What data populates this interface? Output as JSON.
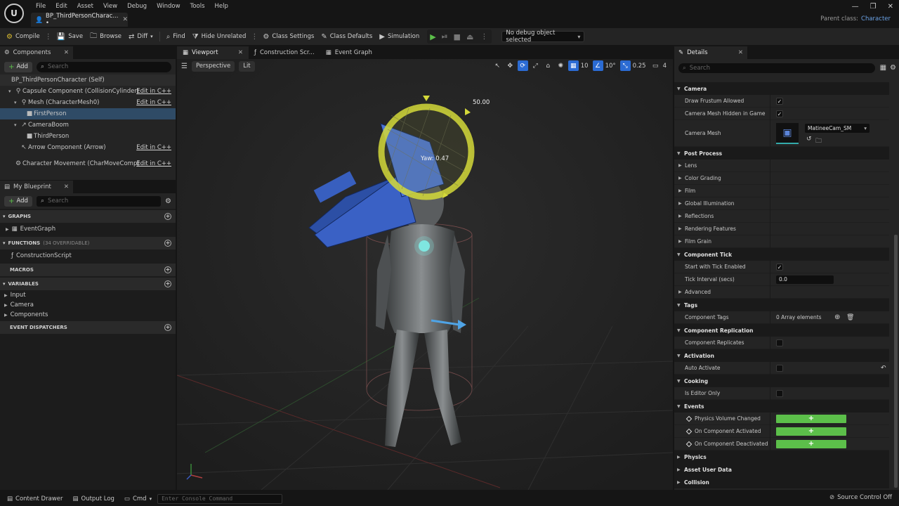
{
  "menu": [
    "File",
    "Edit",
    "Asset",
    "View",
    "Debug",
    "Window",
    "Tools",
    "Help"
  ],
  "asset_tab": {
    "title": "BP_ThirdPersonCharac... •",
    "close": "✕"
  },
  "window_controls": {
    "minimize": "—",
    "maximize": "❐",
    "close": "✕"
  },
  "parent_class": {
    "label": "Parent class:",
    "value": "Character"
  },
  "toolbar": {
    "compile": "Compile",
    "save": "Save",
    "browse": "Browse",
    "diff": "Diff",
    "find": "Find",
    "hide_unrelated": "Hide Unrelated",
    "class_settings": "Class Settings",
    "class_defaults": "Class Defaults",
    "simulation": "Simulation",
    "debug_object": "No debug object selected"
  },
  "components": {
    "title": "Components",
    "add": "Add",
    "search_placeholder": "Search",
    "items": [
      {
        "label": "BP_ThirdPersonCharacter (Self)",
        "edit": ""
      },
      {
        "label": "Capsule Component (CollisionCylinder)",
        "edit": "Edit in C++"
      },
      {
        "label": "Mesh (CharacterMesh0)",
        "edit": "Edit in C++"
      },
      {
        "label": "FirstPerson",
        "edit": ""
      },
      {
        "label": "CameraBoom",
        "edit": ""
      },
      {
        "label": "ThirdPerson",
        "edit": ""
      },
      {
        "label": "Arrow Component (Arrow)",
        "edit": "Edit in C++"
      },
      {
        "label": "Character Movement (CharMoveComp)",
        "edit": "Edit in C++"
      }
    ]
  },
  "my_blueprint": {
    "title": "My Blueprint",
    "add": "Add",
    "search_placeholder": "Search",
    "graphs_header": "GRAPHS",
    "event_graph": "EventGraph",
    "functions_header": "FUNCTIONS",
    "functions_count": "(34 OVERRIDABLE)",
    "construction_script": "ConstructionScript",
    "macros_header": "MACROS",
    "variables_header": "VARIABLES",
    "variables": [
      "Input",
      "Camera",
      "Components"
    ],
    "event_dispatchers_header": "EVENT DISPATCHERS"
  },
  "viewport": {
    "tabs": [
      "Viewport",
      "Construction Scr...",
      "Event Graph"
    ],
    "perspective": "Perspective",
    "lit": "Lit",
    "grid_snap": "10",
    "rot_snap": "10°",
    "scale_snap": "0.25",
    "cam_speed": "4",
    "rotation_value": "50.00",
    "yaw_label": "Yaw: 0.47"
  },
  "details": {
    "title": "Details",
    "search_placeholder": "Search",
    "rows": {
      "camera": "Camera",
      "draw_frustum": "Draw Frustum Allowed",
      "camera_mesh_hidden": "Camera Mesh Hidden in Game",
      "camera_mesh": "Camera Mesh",
      "camera_mesh_value": "MatineeCam_SM",
      "post_process": "Post Process",
      "lens": "Lens",
      "color_grading": "Color Grading",
      "film": "Film",
      "global_illumination": "Global Illumination",
      "reflections": "Reflections",
      "rendering_features": "Rendering Features",
      "film_grain": "Film Grain",
      "component_tick": "Component Tick",
      "start_tick": "Start with Tick Enabled",
      "tick_interval": "Tick Interval (secs)",
      "tick_interval_value": "0.0",
      "advanced": "Advanced",
      "tags": "Tags",
      "component_tags": "Component Tags",
      "component_tags_value": "0 Array elements",
      "component_replication": "Component Replication",
      "component_replicates": "Component Replicates",
      "activation": "Activation",
      "auto_activate": "Auto Activate",
      "cooking": "Cooking",
      "is_editor_only": "Is Editor Only",
      "events": "Events",
      "physics_volume_changed": "Physics Volume Changed",
      "on_component_activated": "On Component Activated",
      "on_component_deactivated": "On Component Deactivated",
      "physics": "Physics",
      "asset_user_data": "Asset User Data",
      "collision": "Collision"
    }
  },
  "statusbar": {
    "content_drawer": "Content Drawer",
    "output_log": "Output Log",
    "cmd": "Cmd",
    "console_placeholder": "Enter Console Command",
    "source_control": "Source Control Off"
  },
  "colors": {
    "accent_blue": "#2b6bd3",
    "play_green": "#5cbf4a",
    "gizmo_yellow": "#d4d93a",
    "selection": "#2f4b66"
  }
}
